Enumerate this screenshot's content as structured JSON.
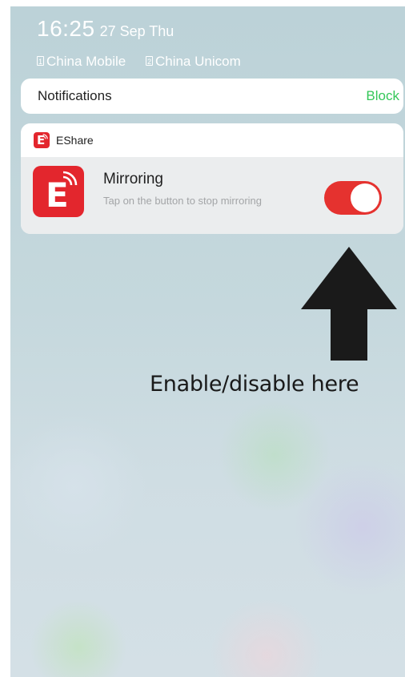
{
  "status_bar": {
    "time": "16:25",
    "date": "27 Sep Thu",
    "carriers": [
      {
        "sim_number": "1",
        "name": "China Mobile"
      },
      {
        "sim_number": "2",
        "name": "China Unicom"
      }
    ]
  },
  "notifications_bar": {
    "title": "Notifications",
    "block_label": "Block"
  },
  "app_notification": {
    "app_name": "EShare",
    "icon_letter": "E",
    "title": "Mirroring",
    "subtitle": "Tap on the button to stop mirroring",
    "toggle_on": true
  },
  "annotation": {
    "text": "Enable/disable here"
  },
  "colors": {
    "accent_green": "#34c759",
    "app_red": "#e3262d",
    "toggle_red": "#e5322f",
    "arrow": "#1a1a1a"
  }
}
